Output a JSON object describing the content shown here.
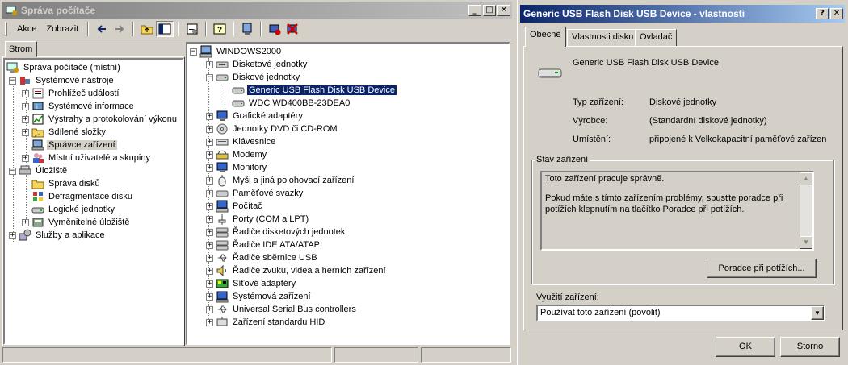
{
  "mmc": {
    "title": "Správa počítače",
    "menu": {
      "action": "Akce",
      "view": "Zobrazit"
    },
    "tree_tab": "Strom",
    "left_tree": [
      "Správa počítače (místní)",
      "Systémové nástroje",
      "Prohlížeč událostí",
      "Systémové informace",
      "Výstrahy a protokolování výkonu",
      "Sdílené složky",
      "Správce zařízení",
      "Místní uživatelé a skupiny",
      "Úložiště",
      "Správa disků",
      "Defragmentace disku",
      "Logické jednotky",
      "Vyměnitelné úložiště",
      "Služby a aplikace"
    ],
    "device_tree": {
      "root": "WINDOWS2000",
      "categories_before": [
        "Disketové jednotky",
        "Diskové jednotky"
      ],
      "disks": [
        "Generic USB Flash Disk USB Device",
        "WDC WD400BB-23DEA0"
      ],
      "categories_after": [
        "Grafické adaptéry",
        "Jednotky DVD či CD-ROM",
        "Klávesnice",
        "Modemy",
        "Monitory",
        "Myši a jiná polohovací zařízení",
        "Paměťové svazky",
        "Počítač",
        "Porty (COM a LPT)",
        "Řadiče disketových jednotek",
        "Řadiče IDE ATA/ATAPI",
        "Řadiče sběrnice USB",
        "Řadiče zvuku, videa a herních zařízení",
        "Síťové adaptéry",
        "Systémová zařízení",
        "Universal Serial Bus controllers",
        "Zařízení standardu HID"
      ]
    }
  },
  "props": {
    "title": "Generic USB Flash Disk USB Device - vlastnosti",
    "tabs": [
      "Obecné",
      "Vlastnosti disku",
      "Ovladač"
    ],
    "device_name": "Generic USB Flash Disk USB Device",
    "fields": [
      {
        "label": "Typ zařízení:",
        "value": "Diskové jednotky"
      },
      {
        "label": "Výrobce:",
        "value": "(Standardní diskové jednotky)"
      },
      {
        "label": "Umístění:",
        "value": "připojené k Velkokapacitní paměťové zařízen"
      }
    ],
    "status_group": "Stav zařízení",
    "status_line1": "Toto zařízení pracuje správně.",
    "status_line2": "Pokud máte s tímto zařízením problémy, spusťte poradce při potížích klepnutím na tlačítko Poradce při potížích.",
    "troubleshoot_button": "Poradce při potížích...",
    "usage_label": "Využití zařízení:",
    "usage_value": "Používat toto zařízení (povolit)",
    "ok_button": "OK",
    "cancel_button": "Storno"
  },
  "colors": {
    "title_active": "#0a246a",
    "title_inactive": "#808080",
    "face": "#d4d0c8",
    "selection": "#0a246a"
  }
}
